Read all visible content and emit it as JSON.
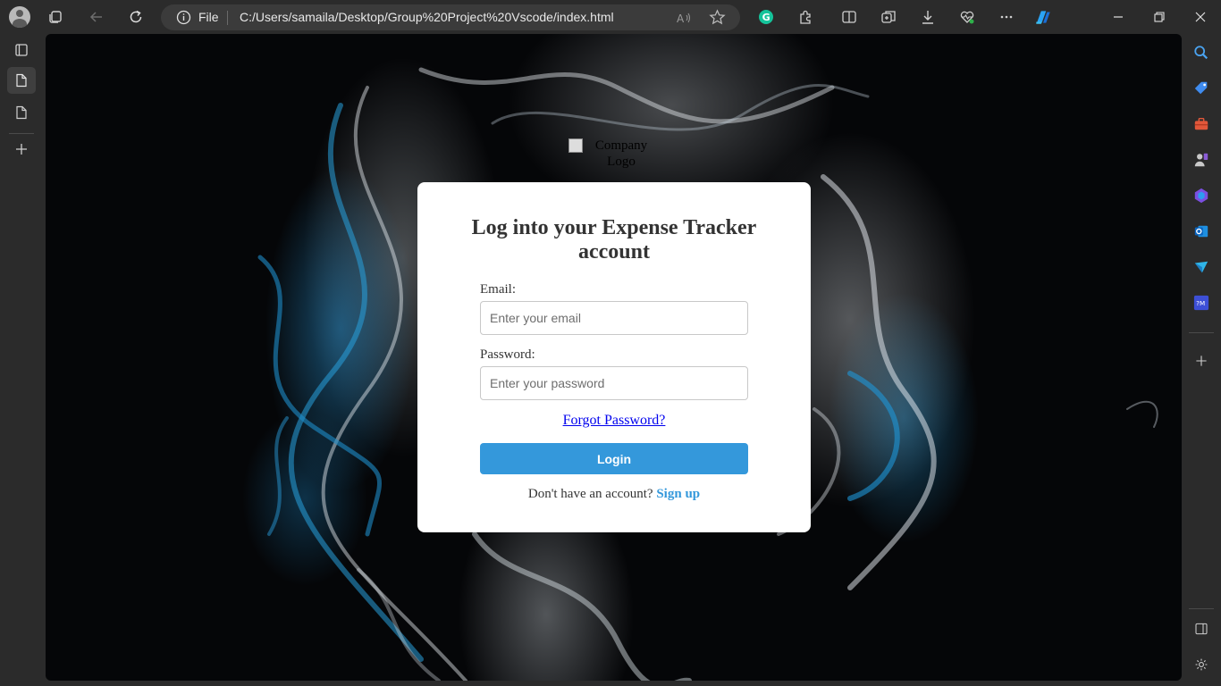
{
  "browser": {
    "address_bar": {
      "scheme_label": "File",
      "url": "C:/Users/samaila/Desktop/Group%20Project%20Vscode/index.html"
    },
    "icons": {
      "profile": "avatar-icon",
      "workspaces": "workspaces-icon",
      "back": "back-arrow-icon",
      "refresh": "refresh-icon",
      "info": "info-icon",
      "read_aloud": "read-aloud-icon",
      "favorite": "star-icon",
      "grammarly": "grammarly-icon",
      "extensions": "puzzle-icon",
      "split_screen": "split-screen-icon",
      "collections": "collections-icon",
      "downloads": "download-icon",
      "health": "heartbeat-icon",
      "more": "more-icon",
      "copilot": "copilot-icon"
    },
    "accent_colors": {
      "grammarly": "#15c39a",
      "copilot": "#2aa3f5"
    }
  },
  "page": {
    "logo_alt": "Company Logo",
    "title": "Log into your Expense Tracker account",
    "email_label": "Email:",
    "email_placeholder": "Enter your email",
    "password_label": "Password:",
    "password_placeholder": "Enter your password",
    "forgot_password": "Forgot Password?",
    "login_button": "Login",
    "signup_prompt": "Don't have an account?",
    "signup_link": "Sign up",
    "colors": {
      "primary": "#3498db",
      "card": "#ffffff",
      "text": "#333333"
    }
  }
}
